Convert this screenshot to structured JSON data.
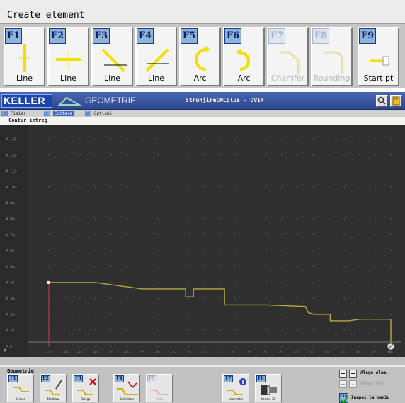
{
  "top_panel": {
    "title": "Create element",
    "keys": [
      {
        "key": "F1",
        "label": "Line",
        "icon": "vertical-line-icon",
        "enabled": true
      },
      {
        "key": "F2",
        "label": "Line",
        "icon": "horizontal-line-icon",
        "enabled": true
      },
      {
        "key": "F3",
        "label": "Line",
        "icon": "angled-line-down-icon",
        "enabled": true
      },
      {
        "key": "F4",
        "label": "Line",
        "icon": "angled-line-up-icon",
        "enabled": true
      },
      {
        "key": "F5",
        "label": "Arc",
        "icon": "arc-cw-icon",
        "enabled": true
      },
      {
        "key": "F6",
        "label": "Arc",
        "icon": "arc-ccw-icon",
        "enabled": true
      },
      {
        "key": "F7",
        "label": "Chamfer",
        "icon": "chamfer-icon",
        "enabled": false
      },
      {
        "key": "F8",
        "label": "Rounding",
        "icon": "rounding-icon",
        "enabled": false
      },
      {
        "key": "F9",
        "label": "Start pt",
        "icon": "start-point-icon",
        "enabled": true
      }
    ]
  },
  "window": {
    "brand": "KELLER",
    "module": "GEOMETRIE",
    "title": "StrunjireCNCplus - OVI4",
    "menus": [
      {
        "key": "F1",
        "label": "Fisier",
        "active": false
      },
      {
        "key": "F2",
        "label": "Editare",
        "active": true
      },
      {
        "key": "F3",
        "label": "Optiuni",
        "active": false
      }
    ],
    "subheader": "Contur intreg"
  },
  "plot": {
    "y_ticks": [
      "# 130-",
      "# 120-",
      "# 110-",
      "# 100-",
      "# 90-",
      "# 80-",
      "# 70-",
      "# 60-",
      "# 50-",
      "# 40-",
      "# 30-",
      "# 20-",
      "# 10-",
      "# 0-"
    ],
    "x_ticks": [
      "-115",
      "-105",
      "-95",
      "-85",
      "-75",
      "-65",
      "-55",
      "-45",
      "-35",
      "-25",
      "-15",
      "-5",
      "5",
      "15",
      "25",
      "35",
      "45",
      "55",
      "65",
      "75",
      "85",
      "95",
      "105"
    ],
    "axis_marker": "Z",
    "colors": {
      "background": "#2f2f2f",
      "grid": "#5a5a5a",
      "contour": "#b8aa3a",
      "start_line": "#b83a3a",
      "axis": "#777777"
    }
  },
  "chart_data": {
    "type": "line",
    "series": [
      {
        "values_xy": [
          [
            -115,
            0
          ],
          [
            -115,
            40
          ],
          [
            -85,
            40
          ],
          [
            -55,
            36
          ],
          [
            -27,
            36
          ],
          [
            -27,
            31
          ],
          [
            -22,
            31
          ],
          [
            -22,
            36
          ],
          [
            -2,
            36
          ],
          [
            -2,
            26
          ],
          [
            25,
            26
          ],
          [
            50,
            25
          ],
          [
            52,
            21
          ],
          [
            56,
            20
          ],
          [
            66,
            20
          ],
          [
            66,
            16
          ],
          [
            78,
            16
          ],
          [
            85,
            17
          ],
          [
            105,
            17
          ],
          [
            105,
            0
          ]
        ]
      }
    ],
    "xlim": [
      -120,
      110
    ],
    "ylim": [
      0,
      135
    ],
    "grid": true
  },
  "bottom_toolbar": {
    "title": "Geometrie",
    "keys": [
      {
        "key": "F1",
        "label": "Creare",
        "icon": "create-icon",
        "enabled": true
      },
      {
        "key": "F2",
        "label": "Modifica",
        "icon": "modify-icon",
        "enabled": true
      },
      {
        "key": "F3",
        "label": "Sterge",
        "icon": "delete-icon",
        "enabled": true
      },
      {
        "key": "F4",
        "label": "Delimitare",
        "icon": "delimit-icon",
        "enabled": true
      },
      {
        "key": "F5",
        "label": "Muta",
        "icon": "move-icon",
        "enabled": false
      },
      {
        "key": "F7",
        "label": "Informatie",
        "icon": "info-icon",
        "enabled": true
      },
      {
        "key": "F8",
        "label": "Vedere 3D",
        "icon": "view-3d-icon",
        "enabled": true
      }
    ],
    "side": [
      {
        "btn1": "+",
        "btn2": "+",
        "label": "Alege elem.",
        "enabled": true
      },
      {
        "btn1": "+",
        "btn2": "-",
        "label": "Alege elm",
        "enabled": false
      }
    ],
    "f10": {
      "key": "F10",
      "label": "Inapoi la meniu"
    }
  }
}
